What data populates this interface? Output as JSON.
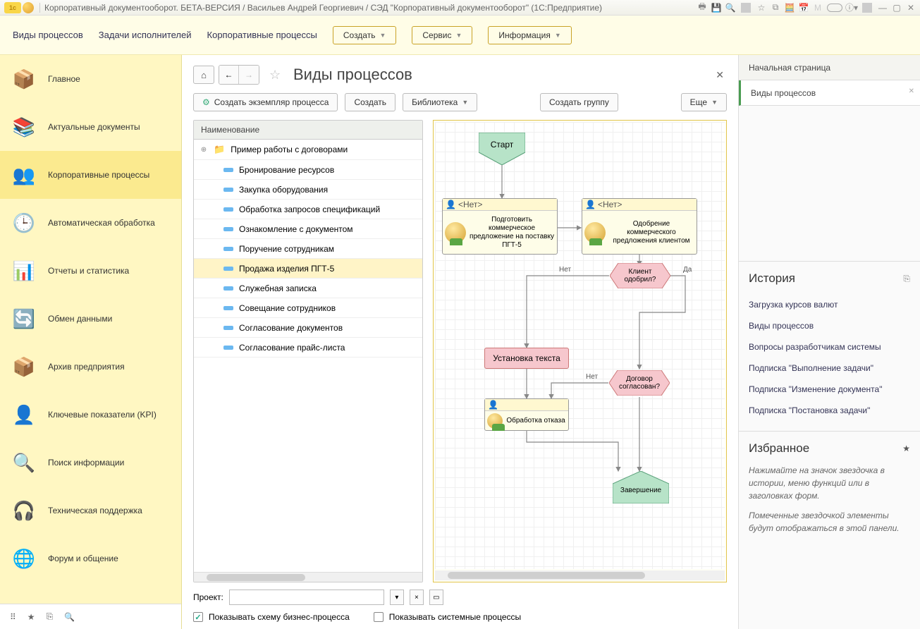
{
  "window_title": "Корпоративный документооборот. БЕТА-ВЕРСИЯ / Васильев Андрей Георгиевич / СЭД \"Корпоративный документооборот\"  (1С:Предприятие)",
  "menubar": {
    "links": [
      "Виды процессов",
      "Задачи исполнителей",
      "Корпоративные процессы"
    ],
    "buttons": [
      "Создать",
      "Сервис",
      "Информация"
    ]
  },
  "sidebar": {
    "items": [
      {
        "label": "Главное",
        "icon": "📦"
      },
      {
        "label": "Актуальные документы",
        "icon": "📚"
      },
      {
        "label": "Корпоративные процессы",
        "icon": "👥",
        "selected": true
      },
      {
        "label": "Автоматическая обработка",
        "icon": "🕒"
      },
      {
        "label": "Отчеты и статистика",
        "icon": "📊"
      },
      {
        "label": "Обмен данными",
        "icon": "🔄"
      },
      {
        "label": "Архив предприятия",
        "icon": "📦"
      },
      {
        "label": "Ключевые показатели (KPI)",
        "icon": "👤"
      },
      {
        "label": "Поиск информации",
        "icon": "🔍"
      },
      {
        "label": "Техническая поддержка",
        "icon": "🎧"
      },
      {
        "label": "Форум и общение",
        "icon": "🌐"
      }
    ]
  },
  "page": {
    "title": "Виды процессов",
    "toolbar": {
      "create_instance": "Создать экземпляр процесса",
      "create": "Создать",
      "library": "Библиотека",
      "create_group": "Создать группу",
      "more": "Еще"
    },
    "tree": {
      "header": "Наименование",
      "folder": "Пример работы с договорами",
      "items": [
        "Бронирование ресурсов",
        "Закупка оборудования",
        "Обработка запросов спецификаций",
        "Ознакомление с документом",
        "Поручение сотрудникам",
        "Продажа изделия ПГТ-5",
        "Служебная записка",
        "Совещание сотрудников",
        "Согласование документов",
        "Согласование прайс-листа"
      ],
      "selected_index": 5
    },
    "diagram": {
      "start": "Старт",
      "task1_owner": "<Нет>",
      "task1": "Подготовить коммерческое предложение на поставку ПГТ-5",
      "task2_owner": "<Нет>",
      "task2": "Одобрение коммерческого предложения клиентом",
      "decision1": "Клиент одобрил?",
      "yes": "Да",
      "no": "Нет",
      "set_text": "Установка текста",
      "decision2": "Договор согласован?",
      "task3": "Обработка отказа",
      "end": "Завершение"
    },
    "project_label": "Проект:",
    "chk1": "Показывать схему бизнес-процесса",
    "chk2": "Показывать системные процессы"
  },
  "rightpane": {
    "tabs": [
      "Начальная страница",
      "Виды процессов"
    ],
    "history_title": "История",
    "history_items": [
      "Загрузка курсов валют",
      "Виды процессов",
      "Вопросы разработчикам системы",
      "Подписка \"Выполнение задачи\"",
      "Подписка \"Изменение документа\"",
      "Подписка \"Постановка задачи\""
    ],
    "favorites_title": "Избранное",
    "fav_note1": "Нажимайте на значок звездочка в истории, меню функций или в заголовках форм.",
    "fav_note2": "Помеченные звездочкой элементы будут отображаться в этой панели."
  }
}
